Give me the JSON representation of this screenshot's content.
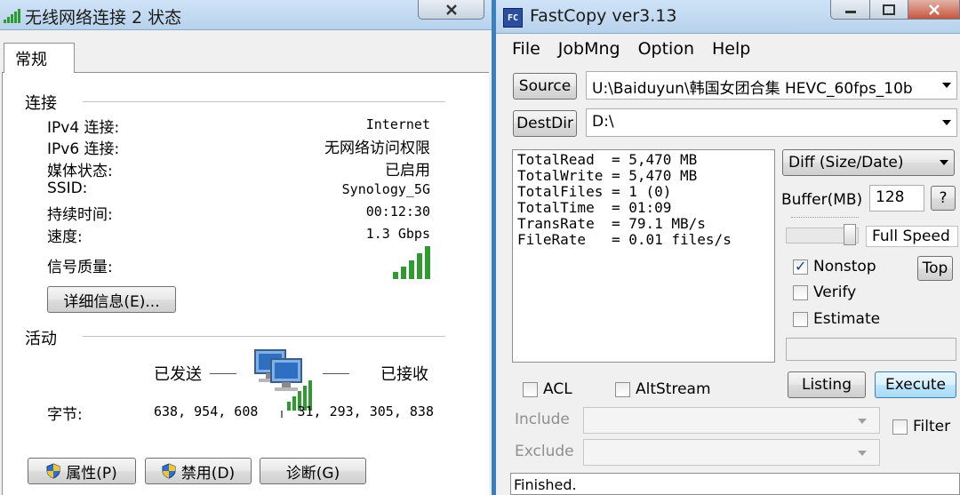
{
  "left_window": {
    "title": "无线网络连接 2 状态",
    "tab_general": "常规",
    "section_connection": "连接",
    "rows": [
      {
        "label": "IPv4 连接:",
        "value": "Internet"
      },
      {
        "label": "IPv6 连接:",
        "value": "无网络访问权限"
      },
      {
        "label": "媒体状态:",
        "value": "已启用"
      },
      {
        "label": "SSID:",
        "value": "Synology_5G"
      },
      {
        "label": "持续时间:",
        "value": "00:12:30"
      },
      {
        "label": "速度:",
        "value": "1.3 Gbps"
      }
    ],
    "signal_label": "信号质量:",
    "details_button": "详细信息(E)...",
    "section_activity": "活动",
    "sent_label": "已发送",
    "received_label": "已接收",
    "bytes_label": "字节:",
    "bytes_sent": "638, 954, 608",
    "bytes_received": "31, 293, 305, 838",
    "properties_button": "属性(P)",
    "disable_button": "禁用(D)",
    "diagnose_button": "诊断(G)"
  },
  "right_window": {
    "icon_text": "FC",
    "title": "FastCopy ver3.13",
    "menu": [
      "File",
      "JobMng",
      "Option",
      "Help"
    ],
    "source_button": "Source",
    "source_path": "U:\\Baiduyun\\韩国女团合集  HEVC_60fps_10b",
    "destdir_button": "DestDir",
    "dest_path": "D:\\",
    "stats": [
      "TotalRead  = 5,470 MB",
      "TotalWrite = 5,470 MB",
      "TotalFiles = 1 (0)",
      "TotalTime  = 01:09",
      "TransRate  = 79.1 MB/s",
      "FileRate   = 0.01 files/s"
    ],
    "mode_select": "Diff (Size/Date)",
    "buffer_label": "Buffer(MB)",
    "buffer_value": "128",
    "help_button": "?",
    "full_speed_label": "Full Speed",
    "nonstop_label": "Nonstop",
    "top_button": "Top",
    "verify_label": "Verify",
    "estimate_label": "Estimate",
    "listing_button": "Listing",
    "execute_button": "Execute",
    "acl_label": "ACL",
    "altstream_label": "AltStream",
    "include_label": "Include",
    "exclude_label": "Exclude",
    "filter_label": "Filter",
    "status_text": "Finished."
  }
}
